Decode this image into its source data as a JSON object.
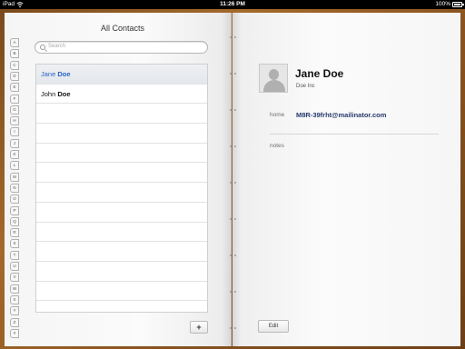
{
  "status_bar": {
    "device": "iPad",
    "time": "11:26 PM",
    "battery": "100%"
  },
  "contacts_list": {
    "title": "All Contacts",
    "search_placeholder": "Search",
    "rows": [
      {
        "first": "Jane",
        "last": "Doe",
        "selected": true
      },
      {
        "first": "John",
        "last": "Doe",
        "selected": false
      }
    ],
    "add_label": "+"
  },
  "alpha_index": [
    "A",
    "B",
    "C",
    "D",
    "E",
    "F",
    "G",
    "H",
    "I",
    "J",
    "K",
    "L",
    "M",
    "N",
    "O",
    "P",
    "Q",
    "R",
    "S",
    "T",
    "U",
    "V",
    "W",
    "X",
    "Y",
    "Z",
    "#"
  ],
  "contact_detail": {
    "name": "Jane Doe",
    "company": "Doe Inc",
    "email_label": "home",
    "email_value": "M8R-39frht@mailinator.com",
    "notes_label": "notes",
    "edit_label": "Edit"
  },
  "colors": {
    "selected_text": "#2a62c9",
    "email_text": "#253a6b",
    "cover": "#8a5420"
  }
}
